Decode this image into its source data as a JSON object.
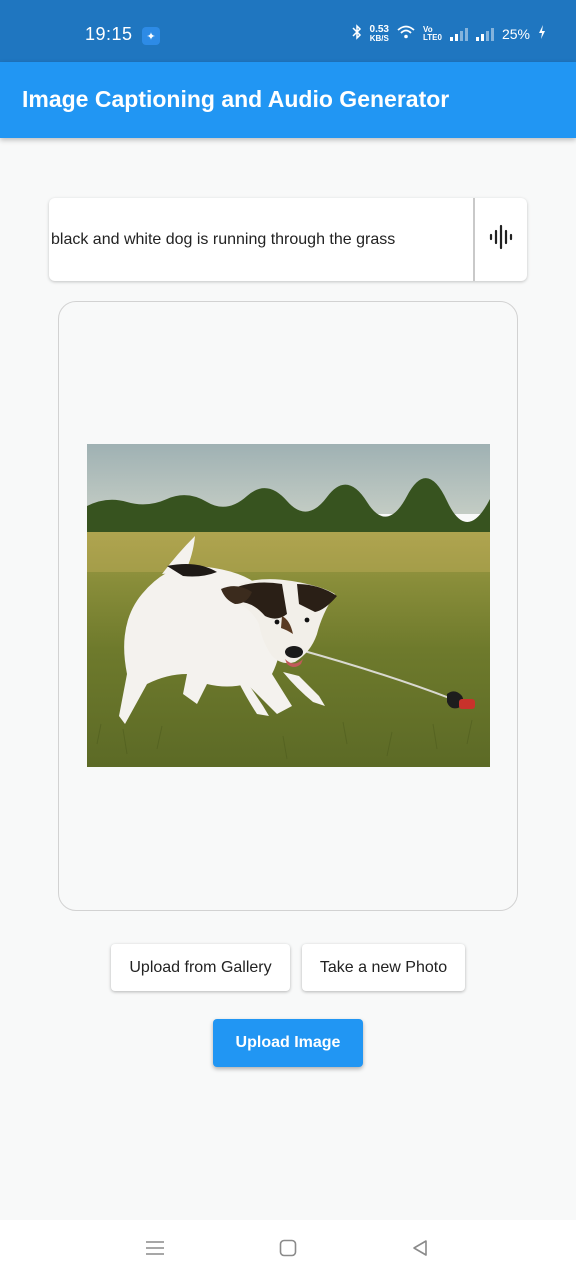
{
  "status_bar": {
    "time": "19:15",
    "net_speed_value": "0.53",
    "net_speed_unit": "KB/S",
    "volte_top": "Vo",
    "volte_bottom": "LTE0",
    "battery": "25%"
  },
  "app_bar": {
    "title": "Image Captioning and Audio Generator"
  },
  "caption": {
    "text": "black and white dog is running through the grass",
    "audio_icon": "audio-waveform-icon"
  },
  "image": {
    "description": "dog running through grass"
  },
  "actions": {
    "gallery_label": "Upload from Gallery",
    "camera_label": "Take a new Photo",
    "upload_label": "Upload Image"
  },
  "nav": {
    "menu_icon": "menu-icon",
    "home_icon": "home-icon",
    "back_icon": "back-icon"
  },
  "colors": {
    "status_bar": "#1f76c0",
    "app_bar": "#2196f3",
    "accent": "#2196f3",
    "background": "#f8f9f9"
  }
}
